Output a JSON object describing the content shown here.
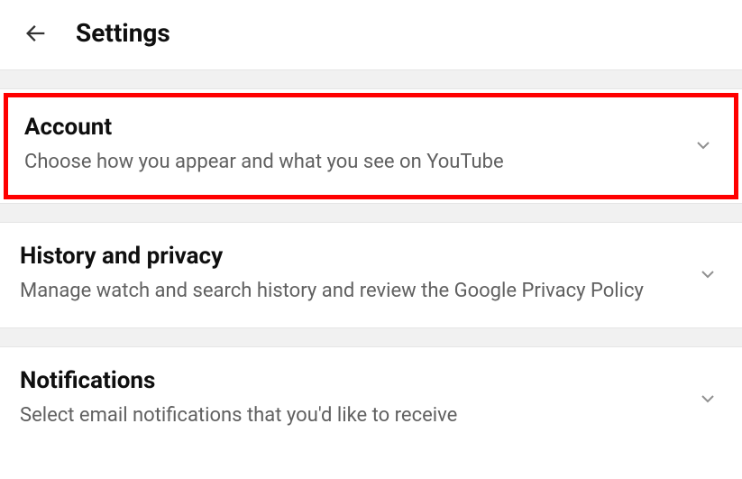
{
  "header": {
    "title": "Settings"
  },
  "items": [
    {
      "title": "Account",
      "description": "Choose how you appear and what you see on YouTube",
      "highlighted": true
    },
    {
      "title": "History and privacy",
      "description": "Manage watch and search history and review the Google Privacy Policy",
      "highlighted": false
    },
    {
      "title": "Notifications",
      "description": "Select email notifications that you'd like to receive",
      "highlighted": false
    }
  ]
}
